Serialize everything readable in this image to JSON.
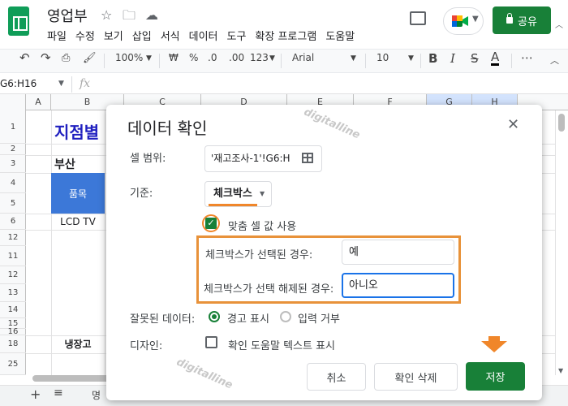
{
  "app": {
    "title": "영업부",
    "menu": [
      "파일",
      "수정",
      "보기",
      "삽입",
      "서식",
      "데이터",
      "도구",
      "확장 프로그램",
      "도움말"
    ],
    "share_label": "공유",
    "brand_color": "#188038"
  },
  "toolbar": {
    "zoom": "100%",
    "currency": "₩",
    "percent": "%",
    "dec_decrease": ".0",
    "dec_increase": ".00",
    "number_format": "123",
    "font": "Arial",
    "font_size": "10",
    "bold": "B",
    "text_color": "A",
    "more": "⋯"
  },
  "formula_bar": {
    "name_box": "G6:H16",
    "fx": "fx"
  },
  "sheet": {
    "columns": [
      "A",
      "B",
      "C",
      "D",
      "E",
      "F",
      "G",
      "H"
    ],
    "rows": [
      "1",
      "2",
      "3",
      "4",
      "5",
      "6",
      "12",
      "11",
      "12",
      "13",
      "14",
      "15",
      "16",
      "17",
      "18",
      "25"
    ],
    "cells": {
      "title": "지점별",
      "busan": "부산",
      "pummok": "품목",
      "lcd": "LCD TV",
      "fridge": "냉장고"
    },
    "tab_name": "명"
  },
  "dialog": {
    "title": "데이터 확인",
    "cell_range_label": "셀 범위:",
    "cell_range_value": "'재고조사-1'!G6:H",
    "criteria_label": "기준:",
    "criteria_value": "체크박스",
    "custom_values_label": "맞춤 셀 값 사용",
    "checked_label": "체크박스가 선택된 경우:",
    "checked_value": "예",
    "unchecked_label": "체크박스가 선택 해제된 경우:",
    "unchecked_value": "아니오",
    "invalid_label": "잘못된 데이터:",
    "option_warn": "경고 표시",
    "option_reject": "입력 거부",
    "appearance_label": "디자인:",
    "help_text_label": "확인 도움말 텍스트 표시",
    "cancel_label": "취소",
    "remove_label": "확인 삭제",
    "save_label": "저장"
  },
  "watermark": "digitalline",
  "highlight_color": "#f0862a"
}
